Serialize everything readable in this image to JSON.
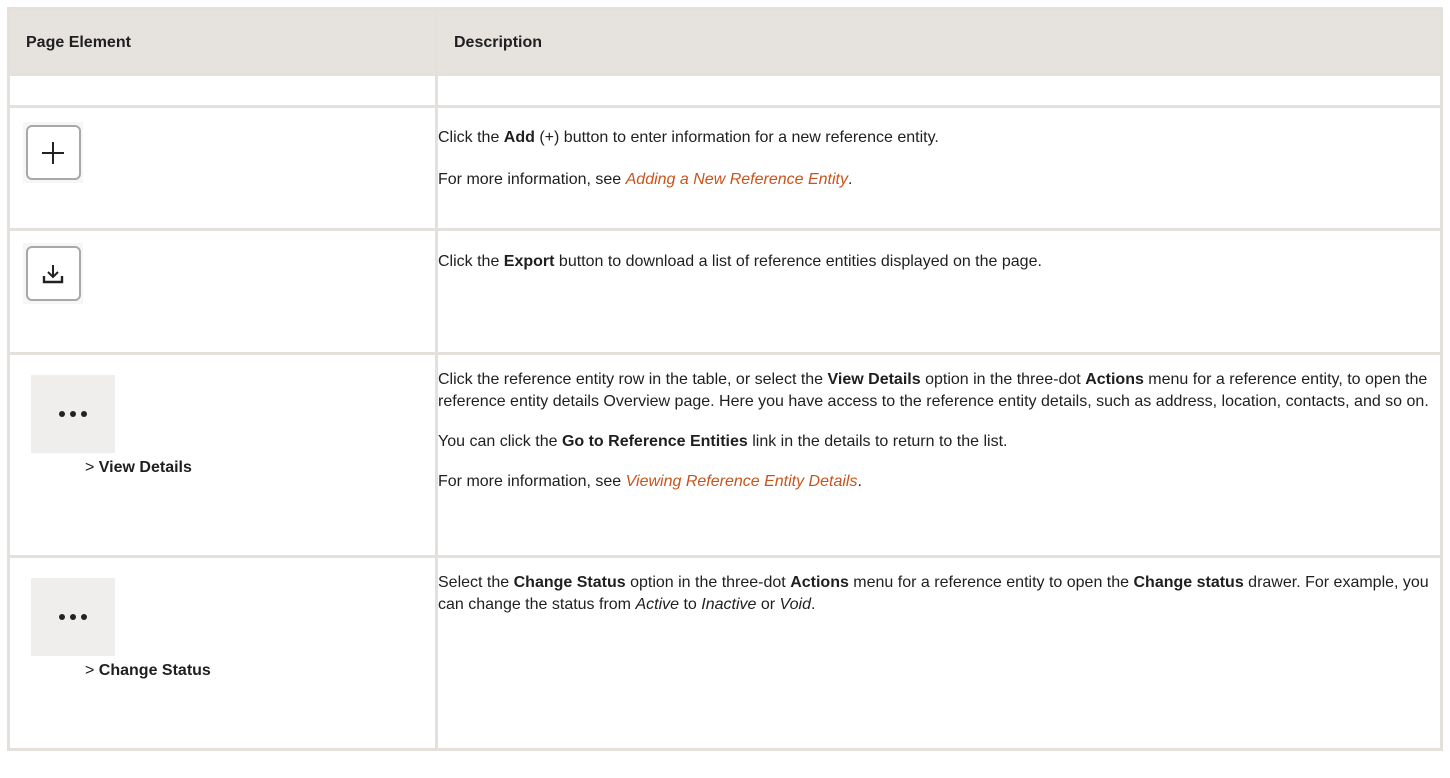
{
  "table": {
    "headers": {
      "page_element": "Page Element",
      "description": "Description"
    },
    "add_row": {
      "icon": "plus-icon",
      "p1_pre": "Click the ",
      "p1_bold": "Add",
      "p1_post": " (+) button to enter information for a new reference entity.",
      "p2_pre": "For more information, see ",
      "p2_link": "Adding a New Reference Entity",
      "p2_post": "."
    },
    "export_row": {
      "icon": "download-icon",
      "p1_pre": "Click the ",
      "p1_bold": "Export",
      "p1_post": " button to download a list of reference entities displayed on the page."
    },
    "view_row": {
      "icon": "three-dot-icon",
      "gt": "> ",
      "label": "View Details",
      "p1_a": "Click the reference entity row in the table, or select the ",
      "p1_b": "View Details",
      "p1_c": " option in the three-dot ",
      "p1_d": "Actions",
      "p1_e": " menu for a reference entity, to open the reference entity details Overview page. Here you have access to the reference entity details, such as address, location, contacts, and so on.",
      "p2_a": "You can click the ",
      "p2_b": "Go to Reference Entities",
      "p2_c": " link in the details to return to the list.",
      "p3_pre": "For more information, see ",
      "p3_link": "Viewing Reference Entity Details",
      "p3_post": "."
    },
    "status_row": {
      "icon": "three-dot-icon",
      "gt": "> ",
      "label": "Change Status",
      "p1_a": "Select the ",
      "p1_b": "Change Status",
      "p1_c": " option in the three-dot ",
      "p1_d": "Actions",
      "p1_e": " menu for a reference entity to open the ",
      "p1_f": "Change status",
      "p1_g": " drawer. For example, you can change the status from ",
      "p1_h": "Active",
      "p1_i": " to ",
      "p1_j": "Inactive",
      "p1_k": " or ",
      "p1_l": "Void",
      "p1_m": "."
    }
  },
  "colors": {
    "header_bg": "#e6e3df",
    "border": "#e4e1dc",
    "link": "#c9541b"
  }
}
